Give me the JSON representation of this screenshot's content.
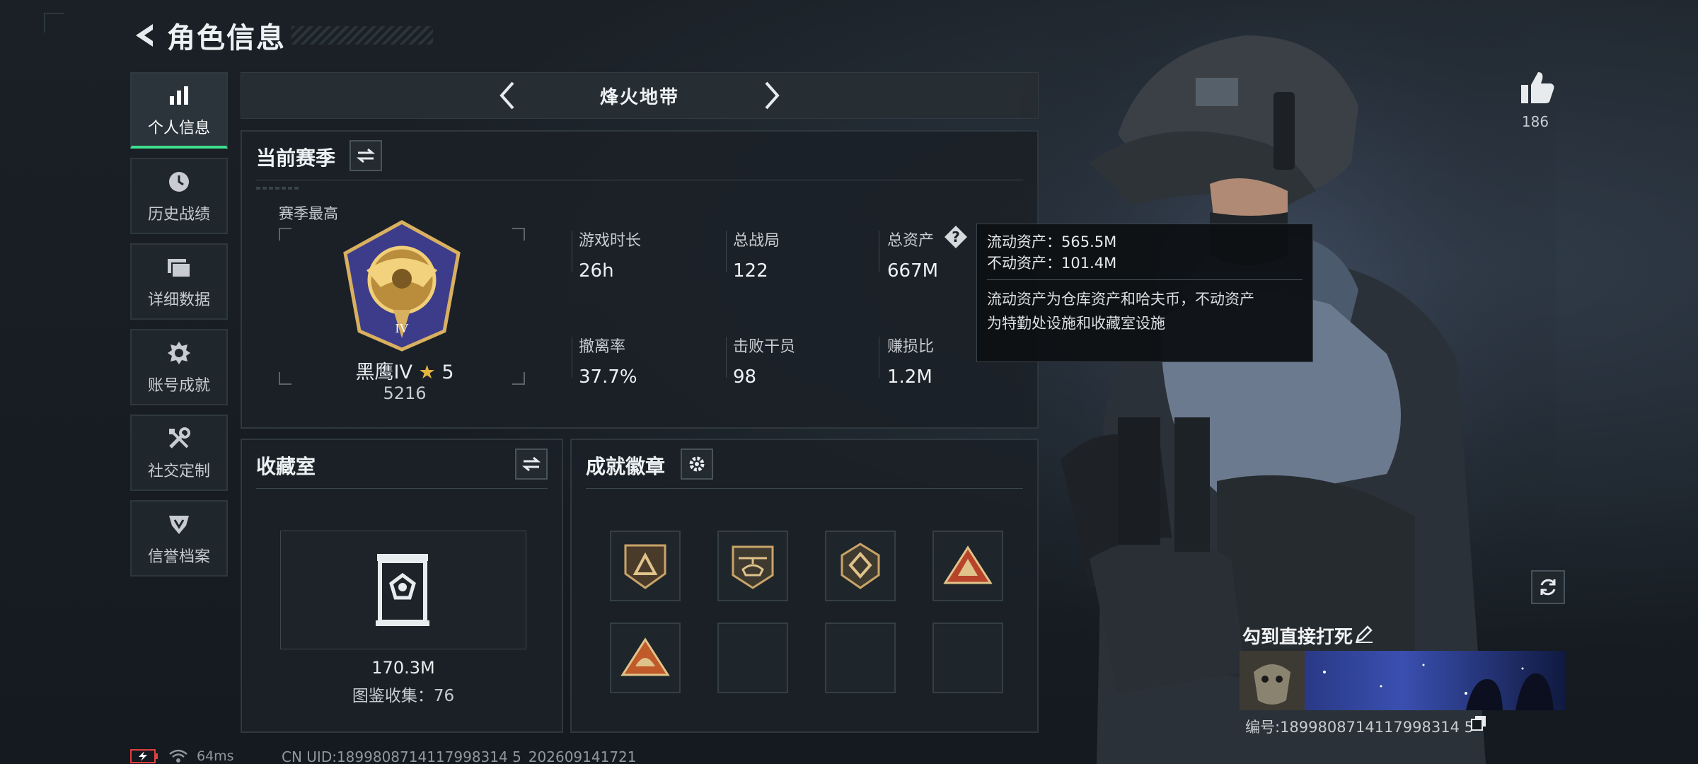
{
  "header": {
    "title": "角色信息"
  },
  "sidebar": {
    "items": [
      {
        "label": "个人信息",
        "icon": "bar-chart-icon",
        "active": true
      },
      {
        "label": "历史战绩",
        "icon": "clock-icon"
      },
      {
        "label": "详细数据",
        "icon": "folder-icon"
      },
      {
        "label": "账号成就",
        "icon": "achievement-icon"
      },
      {
        "label": "社交定制",
        "icon": "tools-icon"
      },
      {
        "label": "信誉档案",
        "icon": "shield-icon"
      }
    ]
  },
  "mode": {
    "name": "烽火地带"
  },
  "season": {
    "title": "当前赛季",
    "best_label": "赛季最高",
    "rank_name": "黑鹰IV",
    "rank_star": "★",
    "rank_stars": "5",
    "rank_points": "5216",
    "stats": [
      {
        "label": "游戏时长",
        "value": "26h"
      },
      {
        "label": "总战局",
        "value": "122"
      },
      {
        "label": "总资产",
        "value": "667M"
      },
      {
        "label": "撤离率",
        "value": "37.7%"
      },
      {
        "label": "击败干员",
        "value": "98"
      },
      {
        "label": "赚损比",
        "value": "1.2M"
      }
    ]
  },
  "tooltip": {
    "liquid": "流动资产：565.5M",
    "fixed": "不动资产：101.4M",
    "desc_line1": "流动资产为仓库资产和哈夫币，不动资产",
    "desc_line2": "为特勤处设施和收藏室设施"
  },
  "collection": {
    "title": "收藏室",
    "value": "170.3M",
    "count": "图鉴收集：76"
  },
  "badges": {
    "title": "成就徽章",
    "slots": [
      {
        "icon": "triangle-badge-icon",
        "filled": true
      },
      {
        "icon": "helicopter-badge-icon",
        "filled": true
      },
      {
        "icon": "diamond-badge-icon",
        "filled": true
      },
      {
        "icon": "pyramid-badge-icon",
        "filled": true
      },
      {
        "icon": "helmet-badge-icon",
        "filled": true
      },
      {
        "icon": "",
        "filled": false
      },
      {
        "icon": "",
        "filled": false
      },
      {
        "icon": "",
        "filled": false
      }
    ]
  },
  "like": {
    "count": "186"
  },
  "player": {
    "name": "勾到直接打死",
    "id": "编号:1899808714117998314 5"
  },
  "status": {
    "ping": "64ms",
    "uid": "CN UID:1899808714117998314 5_202609141721"
  },
  "colors": {
    "accent": "#3ee08f",
    "gold": "#e3b341",
    "panel": "#1b2127"
  }
}
